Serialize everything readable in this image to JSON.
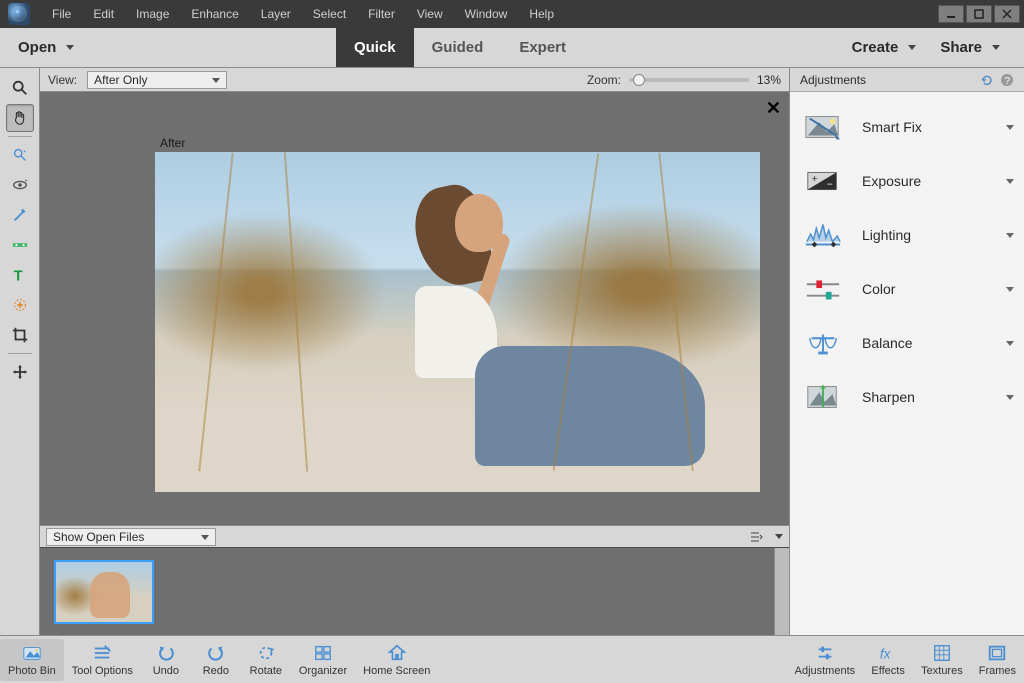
{
  "menubar": {
    "items": [
      "File",
      "Edit",
      "Image",
      "Enhance",
      "Layer",
      "Select",
      "Filter",
      "View",
      "Window",
      "Help"
    ]
  },
  "modebar": {
    "open": "Open",
    "tabs": [
      {
        "label": "Quick",
        "active": true
      },
      {
        "label": "Guided",
        "active": false
      },
      {
        "label": "Expert",
        "active": false
      }
    ],
    "create": "Create",
    "share": "Share"
  },
  "viewbar": {
    "view_label": "View:",
    "view_value": "After Only",
    "zoom_label": "Zoom:",
    "zoom_value": "13%"
  },
  "canvas": {
    "after_label": "After"
  },
  "openfiles": {
    "dropdown": "Show Open Files"
  },
  "rightpanel": {
    "title": "Adjustments",
    "items": [
      {
        "key": "smartfix",
        "label": "Smart Fix"
      },
      {
        "key": "exposure",
        "label": "Exposure"
      },
      {
        "key": "lighting",
        "label": "Lighting"
      },
      {
        "key": "color",
        "label": "Color"
      },
      {
        "key": "balance",
        "label": "Balance"
      },
      {
        "key": "sharpen",
        "label": "Sharpen"
      }
    ]
  },
  "bottombar": {
    "left": [
      {
        "key": "photobin",
        "label": "Photo Bin"
      },
      {
        "key": "tooloptions",
        "label": "Tool Options"
      },
      {
        "key": "undo",
        "label": "Undo"
      },
      {
        "key": "redo",
        "label": "Redo"
      },
      {
        "key": "rotate",
        "label": "Rotate"
      },
      {
        "key": "organizer",
        "label": "Organizer"
      },
      {
        "key": "homescreen",
        "label": "Home Screen"
      }
    ],
    "right": [
      {
        "key": "adjustments",
        "label": "Adjustments"
      },
      {
        "key": "effects",
        "label": "Effects"
      },
      {
        "key": "textures",
        "label": "Textures"
      },
      {
        "key": "frames",
        "label": "Frames"
      }
    ]
  },
  "colors": {
    "accent": "#4a8fd1"
  }
}
